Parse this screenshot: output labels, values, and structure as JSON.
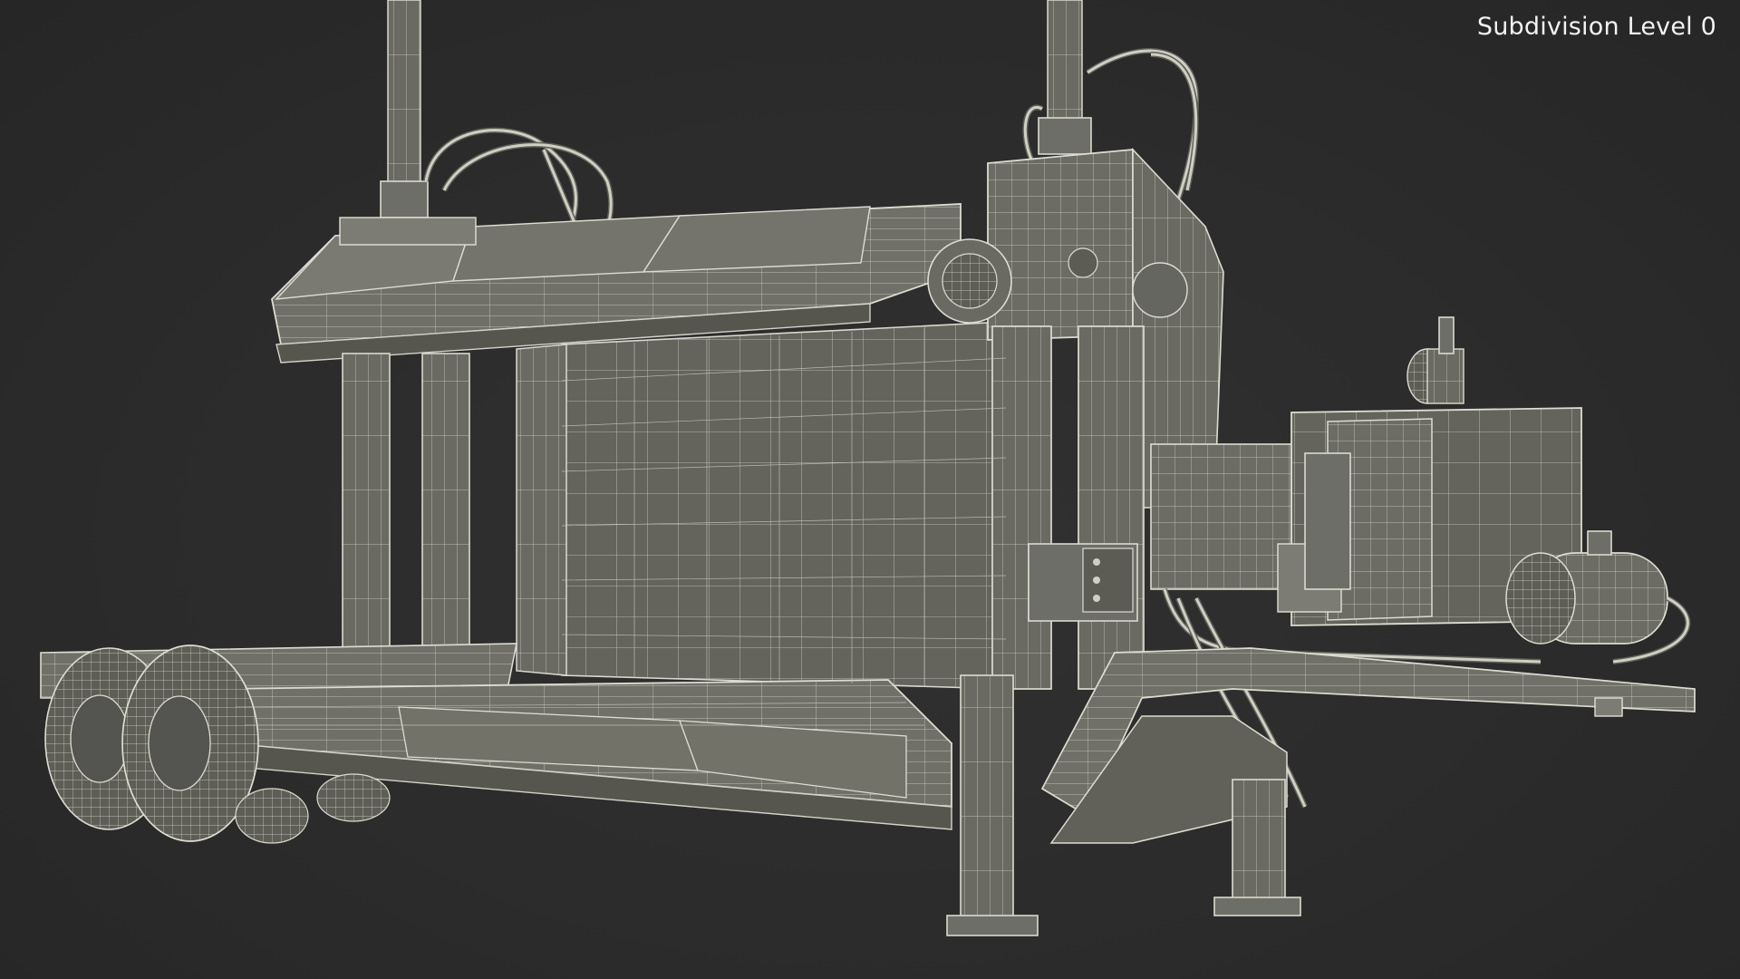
{
  "viewport": {
    "overlay_label": "Subdivision Level 0",
    "background_color": "#2c2c2c",
    "mesh_fill_color": "#6e6e68",
    "wire_color": "#d9d9cf"
  },
  "scene": {
    "subject": "wireframe-3d-model"
  }
}
